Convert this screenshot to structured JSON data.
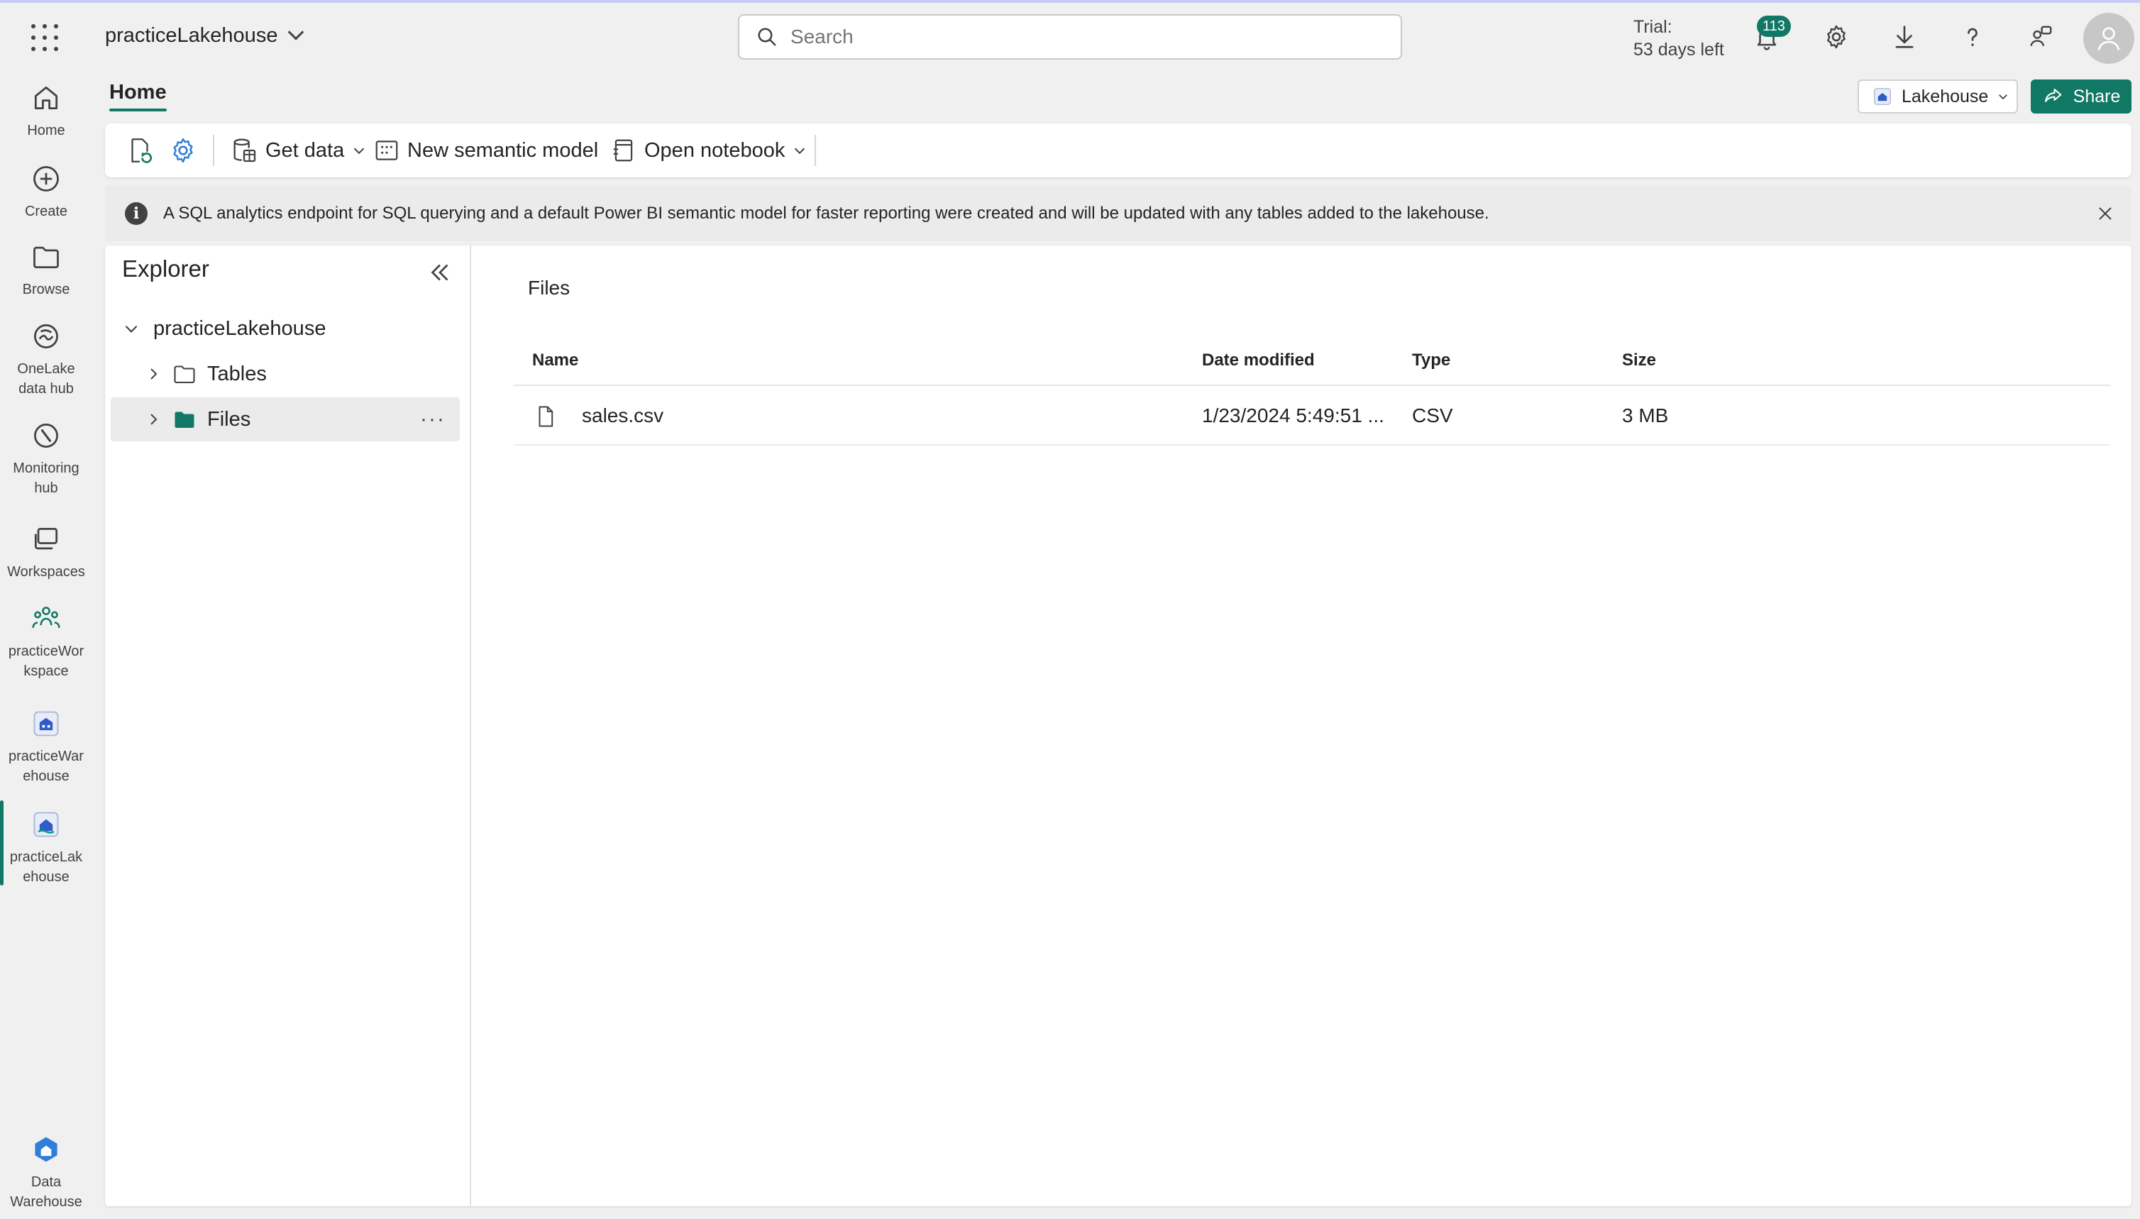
{
  "topbar": {
    "workspace_title": "practiceLakehouse",
    "search_placeholder": "Search",
    "trial_line1": "Trial:",
    "trial_line2": "53 days left",
    "notification_count": "113"
  },
  "rail": {
    "items": [
      {
        "label": "Home",
        "icon": "home-icon"
      },
      {
        "label": "Create",
        "icon": "plus-circle-icon"
      },
      {
        "label": "Browse",
        "icon": "folder-icon"
      },
      {
        "label": "OneLake data hub",
        "icon": "onelake-icon"
      },
      {
        "label": "Monitoring hub",
        "icon": "monitor-icon"
      },
      {
        "label": "Workspaces",
        "icon": "workspaces-icon"
      },
      {
        "label": "practiceWorkspace",
        "icon": "people-icon"
      },
      {
        "label": "practiceWarehouse",
        "icon": "warehouse-icon"
      },
      {
        "label": "practiceLakehouse",
        "icon": "lakehouse-icon"
      },
      {
        "label": "Data Warehouse",
        "icon": "data-warehouse-icon"
      }
    ],
    "labels": {
      "home": "Home",
      "create": "Create",
      "browse": "Browse",
      "onelake_1": "OneLake",
      "onelake_2": "data hub",
      "monitoring_1": "Monitoring",
      "monitoring_2": "hub",
      "workspaces": "Workspaces",
      "pw_1": "practiceWor",
      "pw_2": "kspace",
      "pwh_1": "practiceWar",
      "pwh_2": "ehouse",
      "plh_1": "practiceLak",
      "plh_2": "ehouse",
      "dw_1": "Data",
      "dw_2": "Warehouse"
    }
  },
  "tabs": {
    "home": "Home"
  },
  "header_actions": {
    "lakehouse": "Lakehouse",
    "share": "Share"
  },
  "toolbar": {
    "get_data": "Get data",
    "new_semantic_model": "New semantic model",
    "open_notebook": "Open notebook"
  },
  "infobar": {
    "message": "A SQL analytics endpoint for SQL querying and a default Power BI semantic model for faster reporting were created and will be updated with any tables added to the lakehouse."
  },
  "explorer": {
    "title": "Explorer",
    "root": "practiceLakehouse",
    "tables": "Tables",
    "files": "Files"
  },
  "files": {
    "title": "Files",
    "columns": {
      "name": "Name",
      "date_modified": "Date modified",
      "type": "Type",
      "size": "Size"
    },
    "rows": [
      {
        "name": "sales.csv",
        "date_modified": "1/23/2024 5:49:51 ...",
        "type": "CSV",
        "size": "3 MB"
      }
    ]
  },
  "colors": {
    "accent": "#117865",
    "background": "#f0f0f0",
    "panel": "#ffffff"
  }
}
